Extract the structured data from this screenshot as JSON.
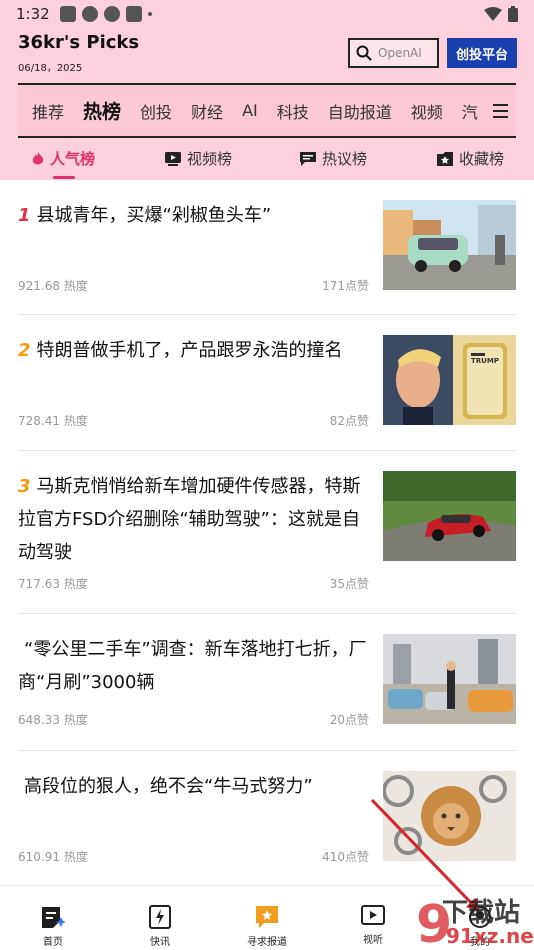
{
  "status_bar": {
    "time": "1:32"
  },
  "header": {
    "brand": "36kr's Picks",
    "date": "06/18，2025",
    "search_placeholder": "OpenAI",
    "cta_label": "创投平台"
  },
  "nav": {
    "items": [
      "推荐",
      "热榜",
      "创投",
      "财经",
      "AI",
      "科技",
      "自助报道",
      "视频",
      "汽"
    ],
    "active": "热榜"
  },
  "tabs": [
    {
      "label": "人气榜",
      "icon": "flame-icon",
      "active": true
    },
    {
      "label": "视频榜",
      "icon": "video-icon",
      "active": false
    },
    {
      "label": "热议榜",
      "icon": "comment-icon",
      "active": false
    },
    {
      "label": "收藏榜",
      "icon": "bookmark-icon",
      "active": false
    }
  ],
  "feed": [
    {
      "rank": "1",
      "title": "县城青年，买爆“剁椒鱼头车”",
      "heat": "921.68 热度",
      "likes": "171点赞"
    },
    {
      "rank": "2",
      "title": "特朗普做手机了，产品跟罗永浩的撞名",
      "heat": "728.41 热度",
      "likes": "82点赞",
      "thumb_text": "TRUMP"
    },
    {
      "rank": "3",
      "title": "马斯克悄悄给新车增加硬件传感器，特斯拉官方FSD介绍删除“辅助驾驶”：这就是自动驾驶",
      "heat": "717.63 热度",
      "likes": "35点赞"
    },
    {
      "rank": "",
      "title": "“零公里二手车”调查：新车落地打七折，厂商“月刷”3000辆",
      "heat": "648.33 热度",
      "likes": "20点赞"
    },
    {
      "rank": "",
      "title": "高段位的狠人，绝不会“牛马式努力”",
      "heat": "610.91 热度",
      "likes": "410点赞"
    }
  ],
  "bottom_nav": [
    {
      "label": "首页",
      "icon": "home-icon"
    },
    {
      "label": "快讯",
      "icon": "flash-icon"
    },
    {
      "label": "寻求报道",
      "icon": "report-icon"
    },
    {
      "label": "视听",
      "icon": "play-icon"
    },
    {
      "label": "我的",
      "icon": "profile-icon"
    }
  ],
  "watermark": {
    "line1": "下载站",
    "line2": "91xz.net"
  },
  "colors": {
    "header_bg": "#fdd0dd",
    "accent": "#e2336b",
    "cta": "#1a3fae"
  }
}
